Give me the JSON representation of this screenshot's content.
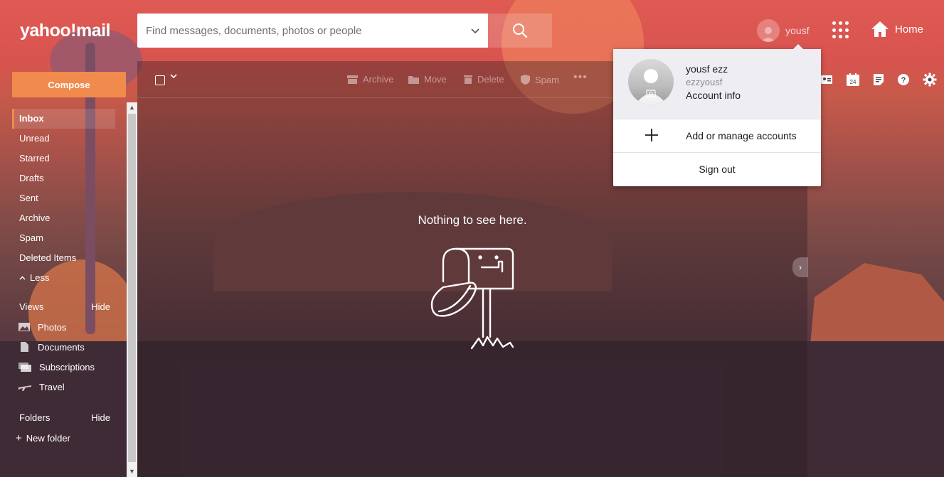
{
  "header": {
    "logo": "yahoo!mail",
    "search_placeholder": "Find messages, documents, photos or people",
    "user_chip": "yousf",
    "home_label": "Home"
  },
  "sidebar": {
    "compose_label": "Compose",
    "folders": [
      {
        "label": "Inbox",
        "active": true
      },
      {
        "label": "Unread"
      },
      {
        "label": "Starred"
      },
      {
        "label": "Drafts"
      },
      {
        "label": "Sent"
      },
      {
        "label": "Archive"
      },
      {
        "label": "Spam"
      },
      {
        "label": "Deleted Items"
      }
    ],
    "less_label": "Less",
    "views_heading": "Views",
    "views_hide": "Hide",
    "views": [
      {
        "label": "Photos",
        "icon": "photo-icon"
      },
      {
        "label": "Documents",
        "icon": "document-icon"
      },
      {
        "label": "Subscriptions",
        "icon": "subscriptions-icon"
      },
      {
        "label": "Travel",
        "icon": "airplane-icon"
      }
    ],
    "folders_heading": "Folders",
    "folders_hide": "Hide",
    "new_folder": "New folder"
  },
  "toolbar": {
    "archive": "Archive",
    "move": "Move",
    "delete": "Delete",
    "spam": "Spam"
  },
  "main": {
    "empty_message": "Nothing to see here."
  },
  "account_menu": {
    "name": "yousf ezz",
    "username": "ezzyousf",
    "account_info": "Account info",
    "add_manage": "Add or manage accounts",
    "sign_out": "Sign out"
  },
  "calendar_day": "24",
  "colors": {
    "accent": "#f08b4d",
    "header_bg": "#d9544f",
    "dropdown_top": "#ededf2"
  }
}
